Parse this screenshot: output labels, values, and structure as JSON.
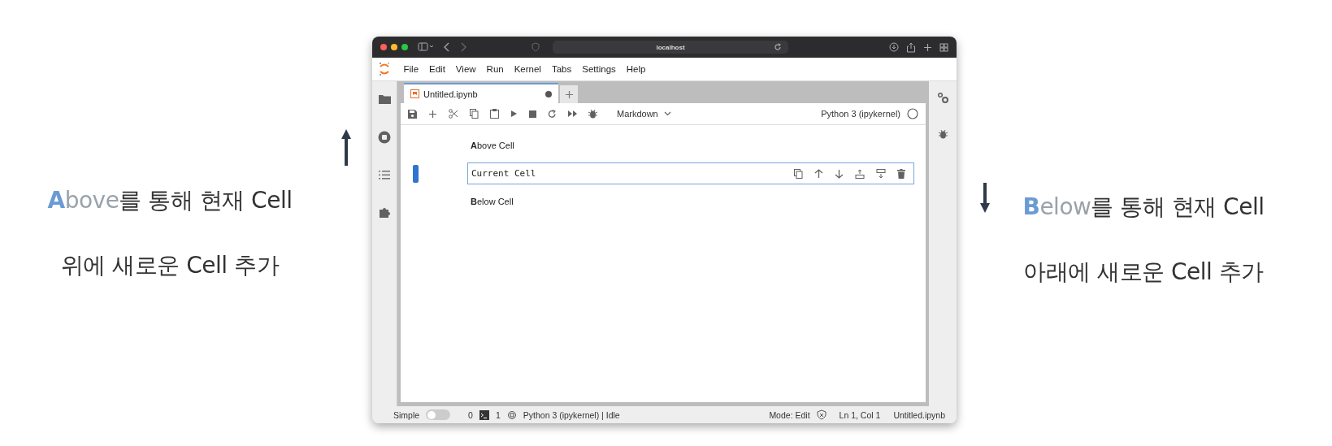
{
  "captions": {
    "left": {
      "key_letter": "A",
      "key_rest": "bove",
      "line_1_tail": "를 통해 현재 Cell",
      "line_2": "위에 새로운 Cell 추가"
    },
    "right": {
      "key_letter": "B",
      "key_rest": "elow",
      "line_1_tail": "를 통해 현재 Cell",
      "line_2": "아래에 새로운 Cell 추가"
    }
  },
  "browser": {
    "address": "localhost"
  },
  "menu": [
    "File",
    "Edit",
    "View",
    "Run",
    "Kernel",
    "Tabs",
    "Settings",
    "Help"
  ],
  "tabs": [
    {
      "label": "Untitled.ipynb",
      "selected": true,
      "unsaved": true
    }
  ],
  "toolbar": {
    "cell_type": "Markdown",
    "kernel": "Python 3 (ipykernel)"
  },
  "cells": [
    {
      "kind": "markdown",
      "text": "**A**bove Cell",
      "active": false
    },
    {
      "kind": "code",
      "text": "Current Cell",
      "active": true
    },
    {
      "kind": "markdown",
      "text": "**B**elow Cell",
      "active": false
    }
  ],
  "status_bar": {
    "mode_label": "Simple",
    "simple_on": false,
    "terminals": "0",
    "kernels": "1",
    "kernel_status": "Python 3 (ipykernel) | Idle",
    "mode": "Mode: Edit",
    "position": "Ln 1, Col 1",
    "file": "Untitled.ipynb"
  }
}
